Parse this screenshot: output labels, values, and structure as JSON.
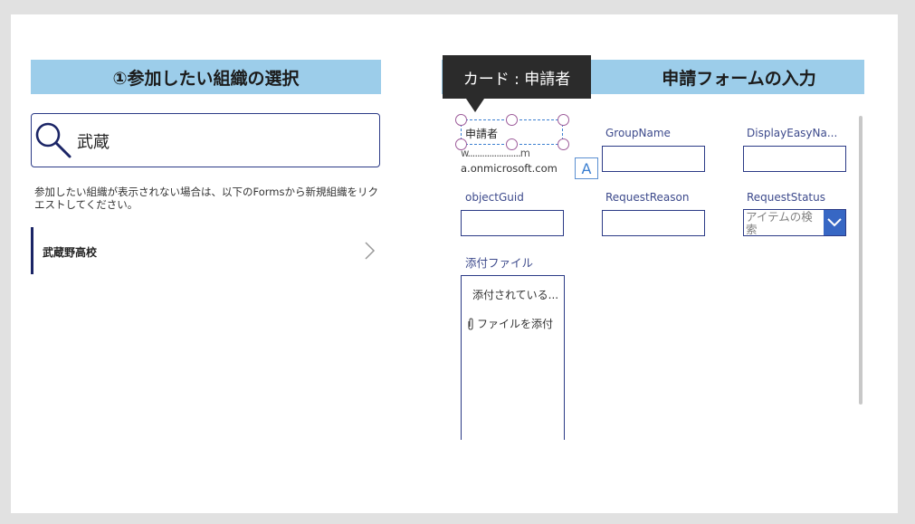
{
  "left_panel": {
    "header": "①参加したい組織の選択",
    "search": {
      "value": "武蔵",
      "icon": "search-icon"
    },
    "help_text": "参加したい組織が表示されない場合は、以下のFormsから新規組織をリクエストしてください。",
    "items": [
      {
        "label": "武蔵野高校",
        "icon": "chevron-right-icon"
      }
    ]
  },
  "right_panel": {
    "header": "申請フォームの入力",
    "selected_card": {
      "label": "申請者",
      "value_line1": "w......................m",
      "value_line2": "a.onmicrosoft.com"
    },
    "fields": {
      "group_name": "GroupName",
      "display_easy_name": "DisplayEasyNa...",
      "object_guid": "objectGuid",
      "request_reason": "RequestReason",
      "request_status": "RequestStatus"
    },
    "dropdown_placeholder": "アイテムの検索",
    "attachments": {
      "label": "添付ファイル",
      "none_text": "添付されている...",
      "add_text": "ファイルを添付"
    }
  },
  "tooltip": {
    "text": "カード : 申請者"
  },
  "text_badge": "A",
  "colors": {
    "header_bg": "#9ccdea",
    "border": "#2b3a86",
    "accent": "#3767c4",
    "selection": "#9d5c9a"
  }
}
